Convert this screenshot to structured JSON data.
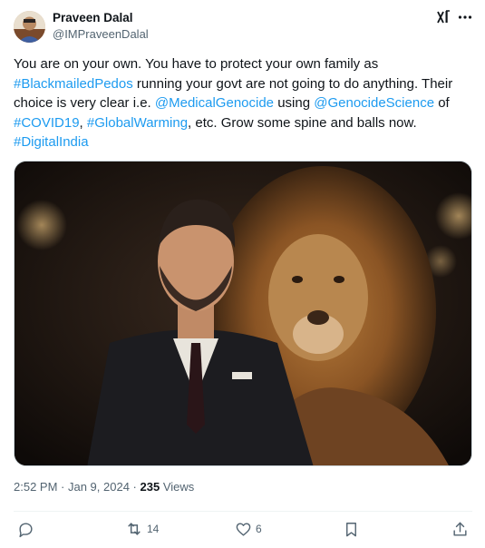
{
  "author": {
    "name": "Praveen Dalal",
    "handle": "@IMPraveenDalal"
  },
  "tweet": {
    "p1": "You are on your own. You have to protect your own family as ",
    "hashtag_blackmailed": "#BlackmailedPedos",
    "p2": " running your govt are not going to do anything. Their choice is very clear i.e. ",
    "mention_medical": "@MedicalGenocide",
    "p3": " using ",
    "mention_science": "@GenocideScience",
    "p4": " of ",
    "hashtag_covid": "#COVID19",
    "p5": ", ",
    "hashtag_warming": "#GlobalWarming",
    "p6": ", etc. Grow some spine and balls now.",
    "hashtag_digital": "#DigitalIndia"
  },
  "meta": {
    "time": "2:52 PM",
    "sep1": " · ",
    "date": "Jan 9, 2024",
    "sep2": " · ",
    "views_count": "235",
    "views_label": " Views"
  },
  "actions": {
    "retweets": "14",
    "likes": "6"
  },
  "colors": {
    "link": "#1d9bf0",
    "text": "#0f1419",
    "secondary": "#536471"
  },
  "icons": [
    "grok-icon",
    "more-icon",
    "reply-icon",
    "retweet-icon",
    "like-icon",
    "bookmark-icon",
    "share-icon"
  ]
}
